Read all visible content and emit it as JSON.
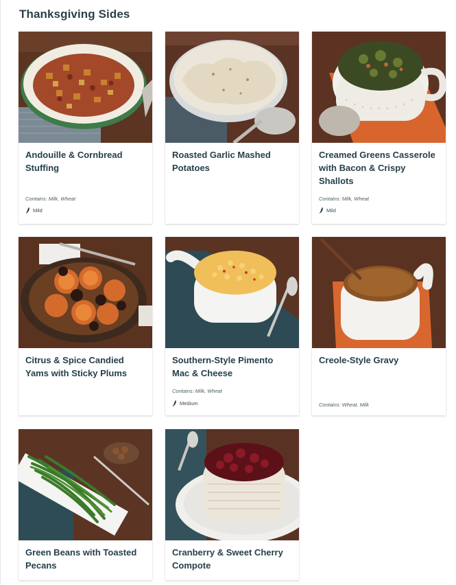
{
  "section": {
    "title": "Thanksgiving Sides"
  },
  "dishes": [
    {
      "name": "Andouille & Cornbread Stuffing",
      "contains": "Contains: Milk, Wheat",
      "spice": "Mild",
      "photo": "stuffing-photo"
    },
    {
      "name": "Roasted Garlic Mashed Potatoes",
      "contains": "",
      "spice": "",
      "photo": "mashed-potatoes-photo"
    },
    {
      "name": "Creamed Greens Casserole with Bacon & Crispy Shallots",
      "contains": "Contains: Milk, Wheat",
      "spice": "Mild",
      "photo": "creamed-greens-photo"
    },
    {
      "name": "Citrus & Spice Candied Yams with Sticky Plums",
      "contains": "",
      "spice": "",
      "photo": "candied-yams-photo"
    },
    {
      "name": "Southern-Style Pimento Mac & Cheese",
      "contains": "Contains: Milk, Wheat",
      "spice": "Medium",
      "photo": "mac-and-cheese-photo"
    },
    {
      "name": "Creole-Style Gravy",
      "contains": "Contains: Wheat, Milk",
      "spice": "",
      "photo": "gravy-photo"
    },
    {
      "name": "Green Beans with Toasted Pecans",
      "contains": "",
      "spice": "",
      "photo": "green-beans-photo"
    },
    {
      "name": "Cranberry & Sweet Cherry Compote",
      "contains": "",
      "spice": "",
      "photo": "cranberry-compote-photo"
    }
  ],
  "icons": {
    "spice": "chili-pepper-icon"
  },
  "colors": {
    "title": "#2a3f4a",
    "text": "#26404b",
    "chili": "#1f3440"
  }
}
